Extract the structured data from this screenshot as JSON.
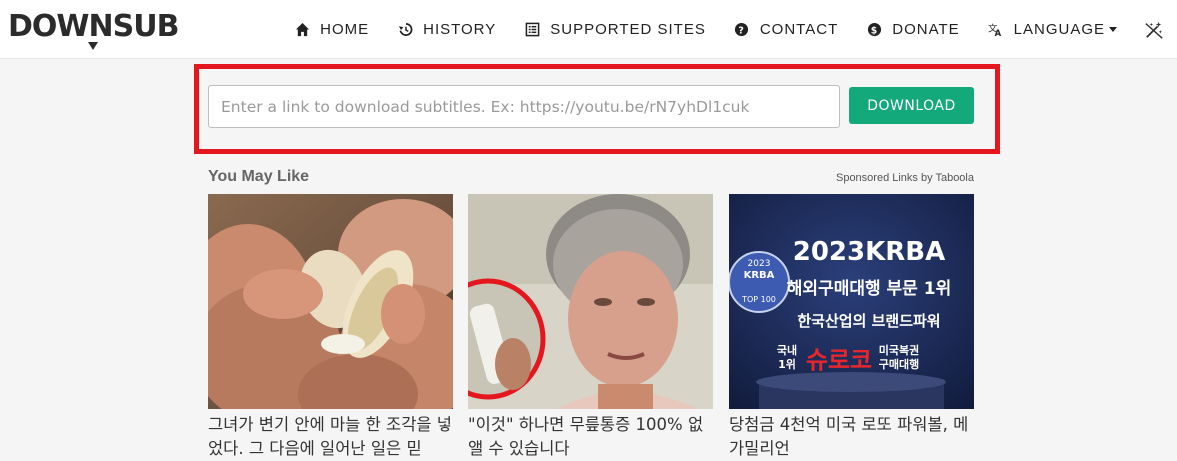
{
  "brand": {
    "logo_text": "DOWNSUB"
  },
  "nav": {
    "items": [
      {
        "label": "HOME",
        "icon": "home-icon"
      },
      {
        "label": "HISTORY",
        "icon": "history-icon"
      },
      {
        "label": "SUPPORTED SITES",
        "icon": "list-icon"
      },
      {
        "label": "CONTACT",
        "icon": "question-icon"
      },
      {
        "label": "DONATE",
        "icon": "dollar-icon"
      },
      {
        "label": "LANGUAGE",
        "icon": "translate-icon"
      }
    ],
    "theme_toggle_icon": "magic-wand-icon"
  },
  "search": {
    "placeholder": "Enter a link to download subtitles. Ex: https://youtu.be/rN7yhDl1cuk",
    "value": "",
    "button_label": "DOWNLOAD",
    "highlight_color": "#e4161e",
    "button_color": "#14a97a"
  },
  "recommendations": {
    "title": "You May Like",
    "sponsor": "Sponsored Links by Taboola",
    "cards": [
      {
        "caption": "그녀가 변기 안에 마늘 한 조각을 넣었다. 그 다음에 일어난 일은 믿"
      },
      {
        "caption": "\"이것\" 하나면 무릎통증 100% 없앨 수 있습니다"
      },
      {
        "caption": "당첨금 4천억 미국 로또 파워볼, 메가밀리언",
        "ad_text": {
          "year_title": "2023KRBA",
          "badge_year": "2023",
          "badge_org": "KRBA",
          "badge_rank": "TOP 100",
          "line1": "해외구매대행 부문 1위",
          "line2": "한국산업의 브랜드파워",
          "rank_small_1": "국내",
          "rank_small_2": "1위",
          "brand": "슈로코",
          "brand_sub_1": "미국복권",
          "brand_sub_2": "구매대행"
        }
      }
    ]
  }
}
